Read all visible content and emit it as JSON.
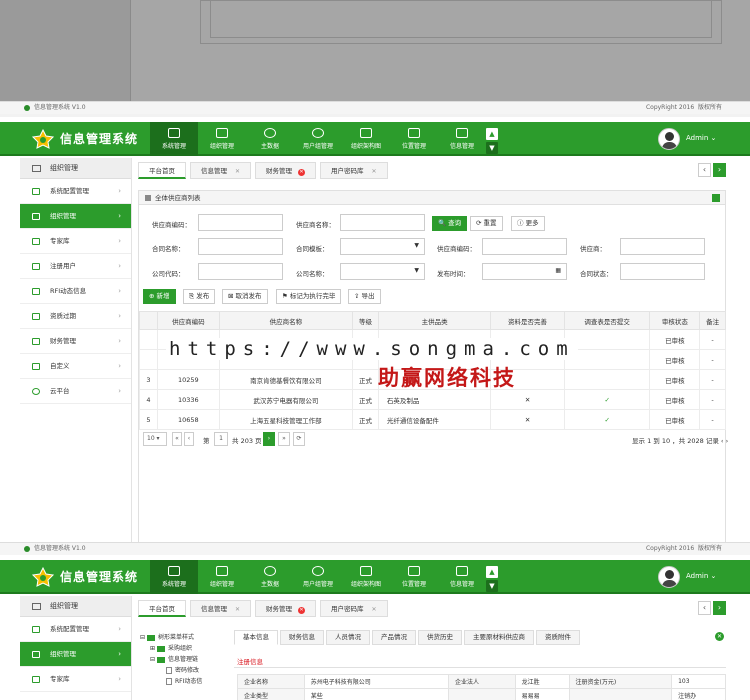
{
  "colors": {
    "accent": "#2c9c2c",
    "watermark_text": "#c41818"
  },
  "app": {
    "title": "信息管理系统",
    "version": "信息管理系统 V1.0",
    "copyright": "CopyRight 2016",
    "rights": "版权所有",
    "user": "Admin"
  },
  "nav": [
    {
      "label": "系统管理",
      "icon": "monitor-icon"
    },
    {
      "label": "组织管理",
      "icon": "grid-icon"
    },
    {
      "label": "主数据",
      "icon": "database-icon"
    },
    {
      "label": "用户组管理",
      "icon": "user-group-icon"
    },
    {
      "label": "组织架构图",
      "icon": "org-chart-icon"
    },
    {
      "label": "位置管理",
      "icon": "location-icon"
    },
    {
      "label": "信息管理",
      "icon": "document-icon"
    }
  ],
  "sidebar": {
    "header": "组织管理",
    "items": [
      "系统配置管理",
      "组织管理",
      "专家库",
      "注册用户",
      "RFI动态信息",
      "资质过期",
      "财务管理",
      "自定义",
      "云平台"
    ]
  },
  "tabs": [
    "平台首页",
    "信息管理",
    "财务管理",
    "用户密码库"
  ],
  "panel": {
    "title": "全体供应商列表"
  },
  "form": {
    "row1": [
      "供应商编码：",
      "供应商名称："
    ],
    "row2": [
      "合同名称：",
      "合同模板：",
      "供应商编码：",
      "供应商："
    ],
    "row3": [
      "公司代码：",
      "公司名称：",
      "发布时间：",
      "合同状态："
    ],
    "search": "查询",
    "reset": "重置",
    "more": "更多"
  },
  "toolbar": [
    "新增",
    "发布",
    "取消发布",
    "标记为执行完毕",
    "导出"
  ],
  "table": {
    "headers": [
      "供应商编码",
      "供应商名称",
      "等级",
      "主供品类",
      "资料是否完善",
      "调查表是否提交",
      "审核状态",
      "备注"
    ],
    "rows": [
      [
        "",
        "",
        "",
        "",
        "",
        "",
        "已审核",
        "-"
      ],
      [
        "",
        "",
        "",
        "",
        "",
        "",
        "已审核",
        "-"
      ],
      [
        "3",
        "10259",
        "南京肯德基餐饮有限公司",
        "正式",
        "",
        "",
        "",
        "已审核",
        "-"
      ],
      [
        "4",
        "10336",
        "武汉苏宁电器有限公司",
        "正式",
        "石英及制品",
        "✕",
        "✓",
        "已审核",
        "-"
      ],
      [
        "5",
        "10658",
        "上海五星科技管理工作部",
        "正式",
        "光纤通信设备配件",
        "✕",
        "✓",
        "已审核",
        "-"
      ]
    ]
  },
  "pager": {
    "size": "10",
    "page_label": "第",
    "page": "1",
    "total_pages": "共 203 页",
    "summary": "显示 1 到 10 ，共 2028 记录"
  },
  "watermark": {
    "url": "https://www.songma.com",
    "cn": "助赢网络科技"
  },
  "detail": {
    "tree": [
      "树形菜单样式",
      "采购组织",
      "信息管理链",
      "密码修改",
      "RFI动态信"
    ],
    "tabs": [
      "基本信息",
      "财务信息",
      "人员情况",
      "产品情况",
      "供货历史",
      "主要原材料供应商",
      "资质附件"
    ],
    "section": "注册信息",
    "grid": [
      [
        "企业名称",
        "苏州电子科技有限公司",
        "企业法人",
        "龙江胜",
        "注册资金(万元)",
        "103"
      ],
      [
        "企业类型",
        "某些",
        "",
        "易易易",
        "",
        "注销办"
      ]
    ]
  }
}
